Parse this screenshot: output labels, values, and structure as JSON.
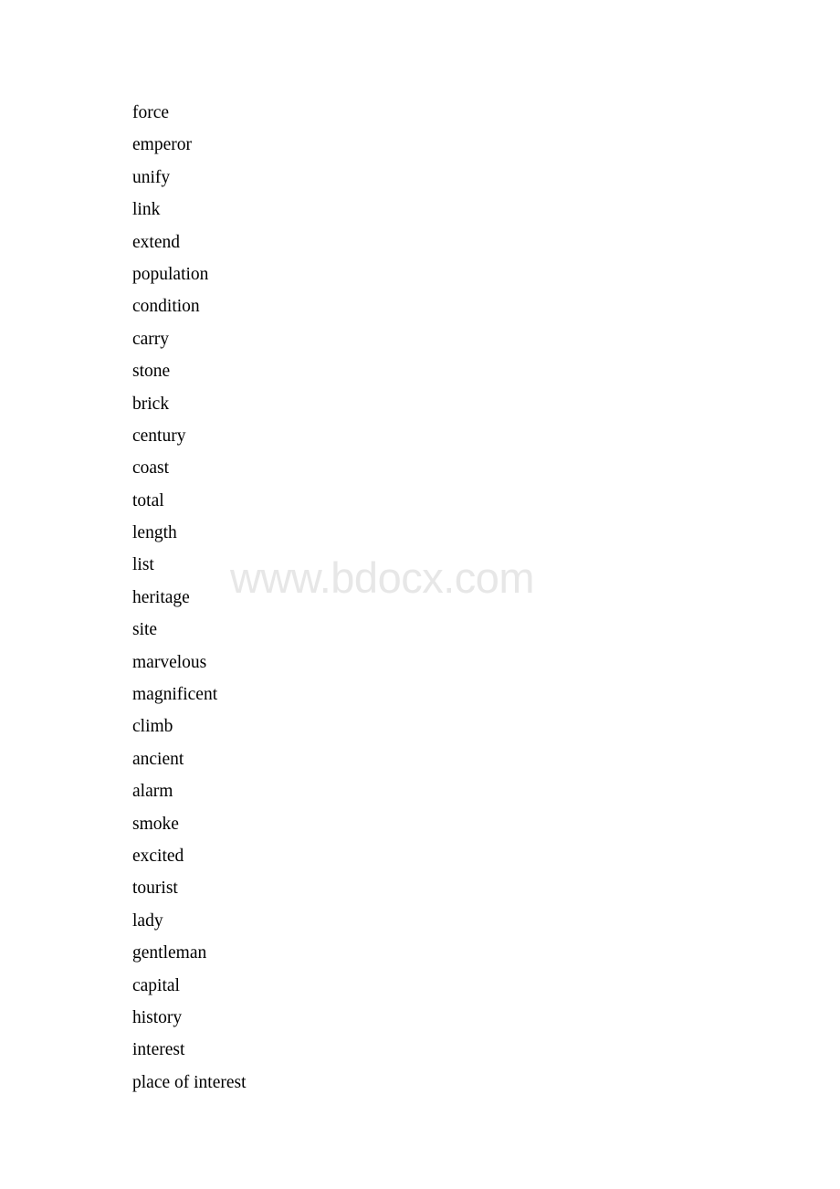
{
  "document": {
    "page_background": "#ffffff",
    "text_color": "#000000"
  },
  "watermark": {
    "text": "www.bdocx.com",
    "color": "#e7e7e7"
  },
  "word_list": {
    "items": [
      {
        "text": "force"
      },
      {
        "text": "emperor"
      },
      {
        "text": "unify"
      },
      {
        "text": "link"
      },
      {
        "text": "extend"
      },
      {
        "text": "population"
      },
      {
        "text": "condition"
      },
      {
        "text": "carry"
      },
      {
        "text": "stone"
      },
      {
        "text": "brick"
      },
      {
        "text": "century"
      },
      {
        "text": "coast"
      },
      {
        "text": "total"
      },
      {
        "text": "length"
      },
      {
        "text": "list"
      },
      {
        "text": "heritage"
      },
      {
        "text": "site"
      },
      {
        "text": "marvelous"
      },
      {
        "text": "magnificent"
      },
      {
        "text": "climb"
      },
      {
        "text": "ancient"
      },
      {
        "text": "alarm"
      },
      {
        "text": "smoke"
      },
      {
        "text": "excited"
      },
      {
        "text": "tourist"
      },
      {
        "text": "lady"
      },
      {
        "text": "gentleman"
      },
      {
        "text": "capital"
      },
      {
        "text": "history"
      },
      {
        "text": "interest"
      },
      {
        "text": "place of interest"
      }
    ]
  }
}
